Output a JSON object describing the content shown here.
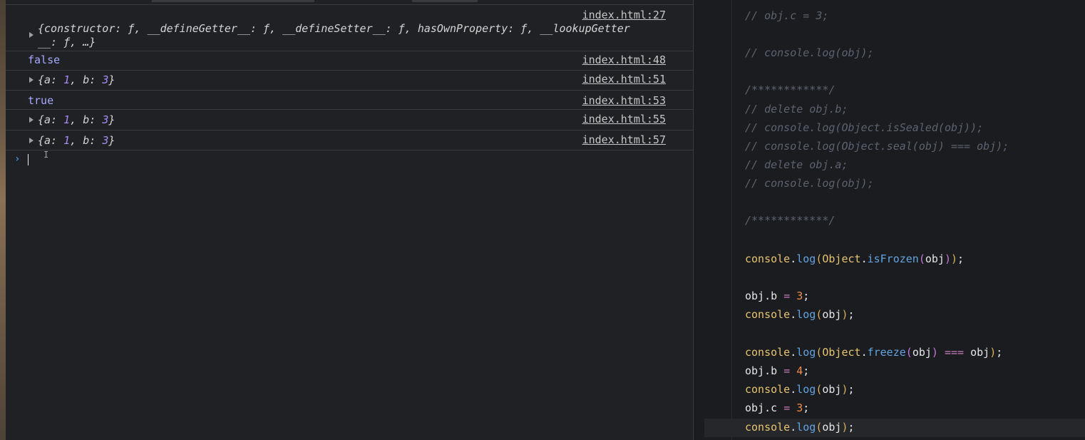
{
  "console": {
    "rows": [
      {
        "source": "index.html:27",
        "text_line1": "{constructor: ƒ, __defineGetter__: ƒ, __defineSetter__: ƒ, hasOwnProperty: ƒ, __lookupGetter",
        "text_line2": "__: ƒ, …}"
      },
      {
        "source": "index.html:48",
        "text": "false"
      },
      {
        "source": "index.html:51",
        "obj_open": "{a: ",
        "a": "1",
        "mid": ", b: ",
        "b": "3",
        "obj_close": "}"
      },
      {
        "source": "index.html:53",
        "text": "true"
      },
      {
        "source": "index.html:55",
        "obj_open": "{a: ",
        "a": "1",
        "mid": ", b: ",
        "b": "3",
        "obj_close": "}"
      },
      {
        "source": "index.html:57",
        "obj_open": "{a: ",
        "a": "1",
        "mid": ", b: ",
        "b": "3",
        "obj_close": "}"
      }
    ],
    "prompt_symbol": "›",
    "ibeam_symbol": "I"
  },
  "editor": {
    "lines": {
      "l1": "// obj.c = 3;",
      "l2": "// console.log(obj);",
      "l3": "/************/",
      "l4": "// delete obj.b;",
      "l5": "// console.log(Object.isSealed(obj));",
      "l6": "// console.log(Object.seal(obj) === obj);",
      "l7": "// delete obj.a;",
      "l8": "// console.log(obj);",
      "l9": "/************/"
    },
    "code": {
      "console": "console",
      "log": "log",
      "Object": "Object",
      "isFrozen": "isFrozen",
      "freeze": "freeze",
      "obj": "obj",
      "val3": "3",
      "val4": "4"
    }
  },
  "colors": {
    "console_bg": "#202124",
    "editor_bg": "#1b1c20",
    "link": "#c6c6c6",
    "boolean": "#a4a8ff",
    "number": "#a38cf5",
    "comment": "#5e6270"
  }
}
